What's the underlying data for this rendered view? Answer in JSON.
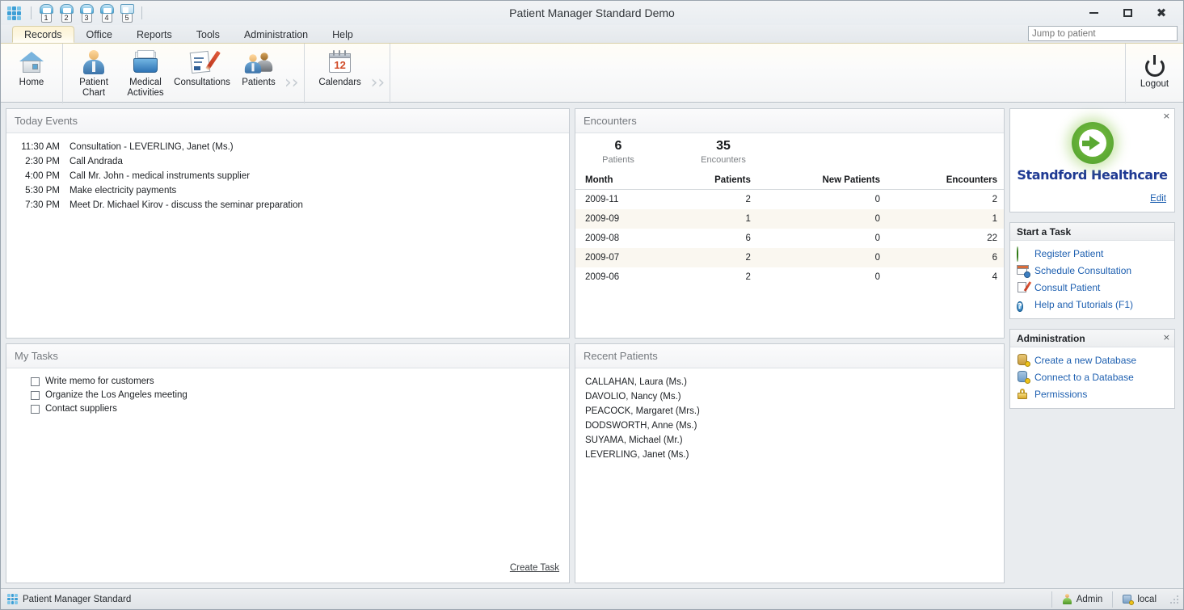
{
  "window": {
    "title": "Patient Manager Standard Demo",
    "minimize_label": "Minimize",
    "maximize_label": "Maximize",
    "close_label": "Close"
  },
  "quick_access": {
    "app_menu_label": "Application Menu",
    "buttons": [
      {
        "num": "1",
        "icon": "patient-chart-icon"
      },
      {
        "num": "2",
        "icon": "patient-chart-icon"
      },
      {
        "num": "3",
        "icon": "medical-activities-icon"
      },
      {
        "num": "4",
        "icon": "consultations-icon"
      },
      {
        "num": "5",
        "icon": "calendars-icon"
      }
    ]
  },
  "ribbon": {
    "tabs": [
      {
        "label": "Records",
        "active": true
      },
      {
        "label": "Office",
        "active": false
      },
      {
        "label": "Reports",
        "active": false
      },
      {
        "label": "Tools",
        "active": false
      },
      {
        "label": "Administration",
        "active": false
      },
      {
        "label": "Help",
        "active": false
      }
    ],
    "jump_to_patient_placeholder": "Jump to patient",
    "jump_to_patient_value": "",
    "group1": [
      {
        "label": "Home",
        "icon": "home-icon"
      }
    ],
    "group2": [
      {
        "label": "Patient\nChart",
        "line1": "Patient",
        "line2": "Chart",
        "icon": "patient-chart-icon"
      },
      {
        "label": "Medical\nActivities",
        "line1": "Medical",
        "line2": "Activities",
        "icon": "medical-activities-icon"
      },
      {
        "label": "Consultations",
        "line1": "Consultations",
        "line2": "",
        "icon": "consultations-icon"
      },
      {
        "label": "Patients",
        "line1": "Patients",
        "line2": "",
        "icon": "patients-icon"
      }
    ],
    "group3": [
      {
        "label": "Calendars",
        "line1": "Calendars",
        "line2": "",
        "icon": "calendars-icon",
        "day": "12"
      }
    ],
    "overflow_glyph": "››",
    "logout_label": "Logout"
  },
  "today_events": {
    "title": "Today Events",
    "rows": [
      {
        "time": "11:30 AM",
        "text": "Consultation - LEVERLING, Janet (Ms.)"
      },
      {
        "time": "2:30 PM",
        "text": "Call Andrada"
      },
      {
        "time": "4:00 PM",
        "text": "Call Mr. John - medical instruments supplier"
      },
      {
        "time": "5:30 PM",
        "text": "Make electricity payments"
      },
      {
        "time": "7:30 PM",
        "text": "Meet Dr. Michael Kirov - discuss the seminar preparation"
      }
    ]
  },
  "my_tasks": {
    "title": "My Tasks",
    "items": [
      {
        "label": "Write memo for customers",
        "checked": false
      },
      {
        "label": "Organize the Los Angeles meeting",
        "checked": false
      },
      {
        "label": "Contact suppliers",
        "checked": false
      }
    ],
    "create_task_label": "Create Task"
  },
  "encounters": {
    "title": "Encounters",
    "stats": [
      {
        "value": "6",
        "label": "Patients"
      },
      {
        "value": "35",
        "label": "Encounters"
      }
    ],
    "columns": [
      "Month",
      "Patients",
      "New Patients",
      "Encounters"
    ],
    "rows": [
      {
        "month": "2009-11",
        "patients": "2",
        "new_patients": "0",
        "encounters": "2"
      },
      {
        "month": "2009-09",
        "patients": "1",
        "new_patients": "0",
        "encounters": "1"
      },
      {
        "month": "2009-08",
        "patients": "6",
        "new_patients": "0",
        "encounters": "22"
      },
      {
        "month": "2009-07",
        "patients": "2",
        "new_patients": "0",
        "encounters": "6"
      },
      {
        "month": "2009-06",
        "patients": "2",
        "new_patients": "0",
        "encounters": "4"
      }
    ]
  },
  "recent_patients": {
    "title": "Recent Patients",
    "items": [
      "CALLAHAN, Laura (Ms.)",
      "DAVOLIO, Nancy (Ms.)",
      "PEACOCK, Margaret (Mrs.)",
      "DODSWORTH, Anne (Ms.)",
      "SUYAMA, Michael (Mr.)",
      "LEVERLING, Janet (Ms.)"
    ]
  },
  "sidebar": {
    "logo_text": "Standford Healthcare",
    "edit_label": "Edit",
    "close_glyph": "×",
    "start_task": {
      "title": "Start a Task",
      "items": [
        {
          "label": "Register Patient",
          "icon": "add-patient-icon"
        },
        {
          "label": "Schedule Consultation",
          "icon": "calendar-clock-icon"
        },
        {
          "label": "Consult Patient",
          "icon": "consult-document-icon"
        },
        {
          "label": "Help and Tutorials  (F1)",
          "icon": "help-icon"
        }
      ]
    },
    "administration": {
      "title": "Administration",
      "items": [
        {
          "label": "Create a new Database",
          "icon": "database-new-icon"
        },
        {
          "label": "Connect to a Database",
          "icon": "database-connect-icon"
        },
        {
          "label": "Permissions",
          "icon": "lock-icon"
        }
      ]
    }
  },
  "statusbar": {
    "app_label": "Patient Manager Standard",
    "user": "Admin",
    "connection": "local"
  },
  "colors": {
    "accent_blue": "#1d5fb0",
    "tab_active": "#fdf3d4",
    "logo_green": "#5aa832",
    "logo_blue": "#1f3a93",
    "alt_row": "#faf7f0"
  }
}
